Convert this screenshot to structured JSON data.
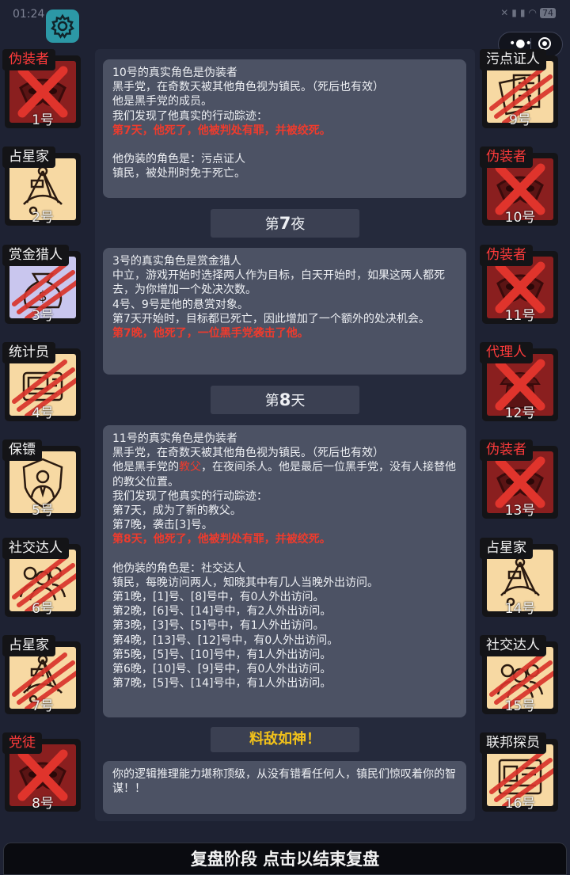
{
  "status_bar": {
    "time": "01:24",
    "icons": [
      "silent-icon",
      "signal-icon",
      "wifi-icon"
    ],
    "battery": "74"
  },
  "settings": {
    "icon": "gear-icon"
  },
  "capsule": {
    "icons": [
      "more-dots-icon",
      "close-circle-icon"
    ]
  },
  "colors": {
    "dead_portrait": "#8a1f1f",
    "alive_portrait": "#f7d9a3",
    "highlight_red": "#ee3b2d",
    "praise_gold": "#f2c21a",
    "settings_teal": "#2c98a6"
  },
  "players_left": [
    {
      "role": "伪装者",
      "number": "1号",
      "state": "eliminated",
      "icon": "mask-icon"
    },
    {
      "role": "占星家",
      "number": "2号",
      "state": "alive",
      "icon": "sextant-icon"
    },
    {
      "role": "赏金猎人",
      "number": "3号",
      "state": "killed",
      "icon": "money-bag-icon"
    },
    {
      "role": "统计员",
      "number": "4号",
      "state": "killed",
      "icon": "device-icon"
    },
    {
      "role": "保镖",
      "number": "5号",
      "state": "alive",
      "icon": "bodyguard-shield-icon"
    },
    {
      "role": "社交达人",
      "number": "6号",
      "state": "killed",
      "icon": "crowd-icon"
    },
    {
      "role": "占星家",
      "number": "7号",
      "state": "killed",
      "icon": "sextant-icon"
    },
    {
      "role": "党徒",
      "number": "8号",
      "state": "eliminated",
      "icon": "mask-icon"
    }
  ],
  "players_right": [
    {
      "role": "污点证人",
      "number": "9号",
      "state": "killed",
      "icon": "documents-icon"
    },
    {
      "role": "伪装者",
      "number": "10号",
      "state": "eliminated",
      "icon": "mask-icon"
    },
    {
      "role": "伪装者",
      "number": "11号",
      "state": "eliminated",
      "icon": "mask-icon"
    },
    {
      "role": "代理人",
      "number": "12号",
      "state": "eliminated",
      "icon": "agent-hat-icon"
    },
    {
      "role": "伪装者",
      "number": "13号",
      "state": "eliminated",
      "icon": "mask-icon"
    },
    {
      "role": "占星家",
      "number": "14号",
      "state": "alive",
      "icon": "sextant-icon"
    },
    {
      "role": "社交达人",
      "number": "15号",
      "state": "killed",
      "icon": "crowd-icon"
    },
    {
      "role": "联邦探员",
      "number": "16号",
      "state": "killed",
      "icon": "badge-icon"
    }
  ],
  "log": {
    "card1": {
      "l1": "10号的真实角色是伪装者",
      "l2": "黑手党，在奇数天被其他角色视为镇民。（死后也有效）",
      "l3": "他是黑手党的成员。",
      "l4": "我们发现了他真实的行动踪迹：",
      "l5": "第7天，他死了，他被判处有罪，并被绞死。",
      "l6": "他伪装的角色是：污点证人",
      "l7": "镇民，被处刑时免于死亡。"
    },
    "divider1": {
      "prefix": "第",
      "number": "7",
      "suffix": "夜"
    },
    "card2": {
      "l1": "3号的真实角色是赏金猎人",
      "l2": "中立，游戏开始时选择两人作为目标，白天开始时，如果这两人都死去，为你增加一个处决次数。",
      "l3": "4号、9号是他的悬赏对象。",
      "l4": "第7天开始时，目标都已死亡，因此增加了一个额外的处决机会。",
      "l5": "第7晚，他死了，一位黑手党袭击了他。"
    },
    "divider2": {
      "prefix": "第",
      "number": "8",
      "suffix": "天"
    },
    "card3": {
      "l1": "11号的真实角色是伪装者",
      "l2": "黑手党，在奇数天被其他角色视为镇民。（死后也有效）",
      "l3a": "他是黑手党的",
      "l3b": "教父",
      "l3c": "，在夜间杀人。他是最后一位黑手党，没有人接替他的教父位置。",
      "l4": "我们发现了他真实的行动踪迹：",
      "l5": "第7天，成为了新的教父。",
      "l6": "第7晚，袭击[3]号。",
      "l7": "第8天，他死了，他被判处有罪，并被绞死。",
      "l8": "他伪装的角色是：社交达人",
      "l9": "镇民，每晚访问两人，知晓其中有几人当晚外出访问。",
      "nights": [
        "第1晚，[1]号、[8]号中，有0人外出访问。",
        "第2晚，[6]号、[14]号中，有2人外出访问。",
        "第3晚，[3]号、[5]号中，有1人外出访问。",
        "第4晚，[13]号、[12]号中，有0人外出访问。",
        "第5晚，[5]号、[10]号中，有1人外出访问。",
        "第6晚，[10]号、[9]号中，有0人外出访问。",
        "第7晚，[5]号、[14]号中，有1人外出访问。"
      ]
    },
    "divider3": {
      "title": "料敌如神！"
    },
    "card4": {
      "text": "你的逻辑推理能力堪称顶级，从没有错看任何人，镇民们惊叹着你的智谋！！"
    }
  },
  "bottom_bar": {
    "label": "复盘阶段 点击以结束复盘"
  }
}
